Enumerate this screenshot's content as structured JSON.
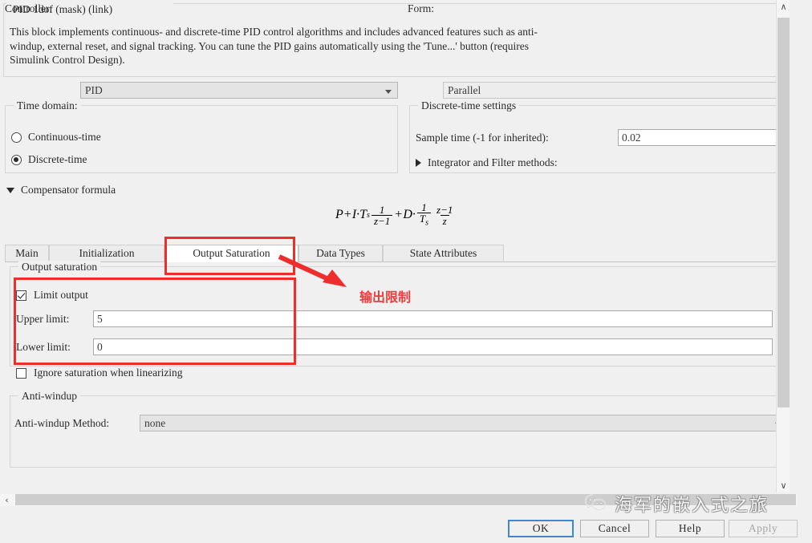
{
  "mask": {
    "title": "PID 1dof (mask) (link)",
    "description": "This block implements continuous- and discrete-time PID control algorithms and includes advanced features such as anti-\nwindup, external reset, and signal tracking. You can tune the PID gains automatically using the 'Tune...' button (requires\nSimulink Control Design)."
  },
  "controller": {
    "label": "Controller:",
    "value": "PID"
  },
  "form": {
    "label": "Form:",
    "value": "Parallel"
  },
  "time_domain": {
    "title": "Time domain:",
    "options": [
      {
        "label": "Continuous-time",
        "selected": false
      },
      {
        "label": "Discrete-time",
        "selected": true
      }
    ]
  },
  "discrete_settings": {
    "title": "Discrete-time settings",
    "sample_time_label": "Sample time (-1 for inherited):",
    "sample_time_value": "0.02",
    "integrator_expander": "Integrator and Filter methods:"
  },
  "compensator": {
    "expander_label": "Compensator formula",
    "formula": {
      "p": "P",
      "plus1": "+",
      "i": "I·T",
      "i_sub": "s",
      "frac1_num": "1",
      "frac1_den": "z−1",
      "plus2": "+",
      "d": "D·",
      "frac2_num": "1",
      "frac2_den": "T",
      "frac2_den_sub": "s",
      "frac3_num": "z−1",
      "frac3_den": "z"
    }
  },
  "tabs": [
    {
      "label": "Main",
      "active": false
    },
    {
      "label": "Initialization",
      "active": false
    },
    {
      "label": "Output Saturation",
      "active": true
    },
    {
      "label": "Data Types",
      "active": false
    },
    {
      "label": "State Attributes",
      "active": false
    }
  ],
  "output_saturation": {
    "group_title": "Output saturation",
    "limit_output_label": "Limit output",
    "limit_output_checked": true,
    "upper_limit_label": "Upper limit:",
    "upper_limit_value": "5",
    "lower_limit_label": "Lower limit:",
    "lower_limit_value": "0",
    "ignore_saturation_label": "Ignore saturation when linearizing",
    "ignore_saturation_checked": false
  },
  "anti_windup": {
    "group_title": "Anti-windup",
    "method_label": "Anti-windup Method:",
    "method_value": "none"
  },
  "buttons": {
    "ok": "OK",
    "cancel": "Cancel",
    "help": "Help",
    "apply": "Apply"
  },
  "annotation": {
    "text": "输出限制",
    "color": "#ef3b3b",
    "box_color": "#ef2d2d"
  },
  "watermark": {
    "text": "海军的嵌入式之旅"
  },
  "scroll": {
    "up_arrow": "∧",
    "down_arrow": "∨",
    "left_arrow": "‹"
  }
}
